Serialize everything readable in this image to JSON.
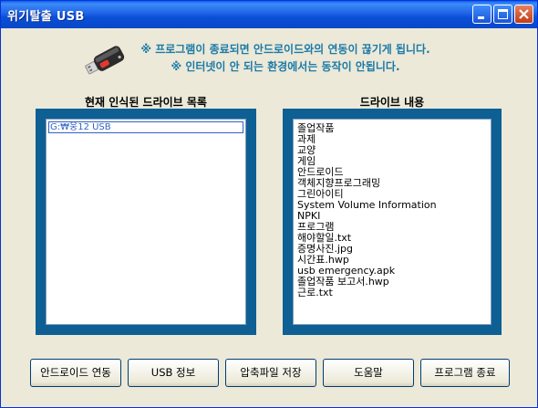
{
  "window": {
    "title": "위기탈출 USB",
    "controls": {
      "minimize": "minimize-icon",
      "maximize": "maximize-icon",
      "close": "close-icon"
    }
  },
  "notice": {
    "icon": "usb-drive-icon",
    "line1": "※ 프로그램이 종료되면 안드로이드와의 연동이 끊기게 됩니다.",
    "line2": "※ 인터넷이 안 되는 환경에서는 동작이 안됩니다."
  },
  "drives": {
    "heading": "현재 인식된 드라이브 목록",
    "items": [
      "G:₩웅12 USB"
    ],
    "selected_index": 0
  },
  "contents": {
    "heading": "드라이브 내용",
    "items": [
      "졸업작품",
      "과제",
      "교양",
      "게임",
      "안드로이드",
      "객체지향프로그래밍",
      "그린아이티",
      "System Volume Information",
      "NPKI",
      "프로그램",
      "해야할일.txt",
      "증명사진.jpg",
      "시간표.hwp",
      "usb emergency.apk",
      "졸업작품 보고서.hwp",
      "근로.txt"
    ]
  },
  "buttons": {
    "android_link": "안드로이드 연동",
    "usb_info": "USB 정보",
    "save_zip": "압축파일 저장",
    "help": "도움말",
    "exit": "프로그램 종료"
  },
  "colors": {
    "title_bar": "#0a4fd6",
    "notice_text": "#1c7aa8",
    "frame": "#0d5f94",
    "selection": "#3163c6",
    "window_bg": "#ece9d8"
  }
}
